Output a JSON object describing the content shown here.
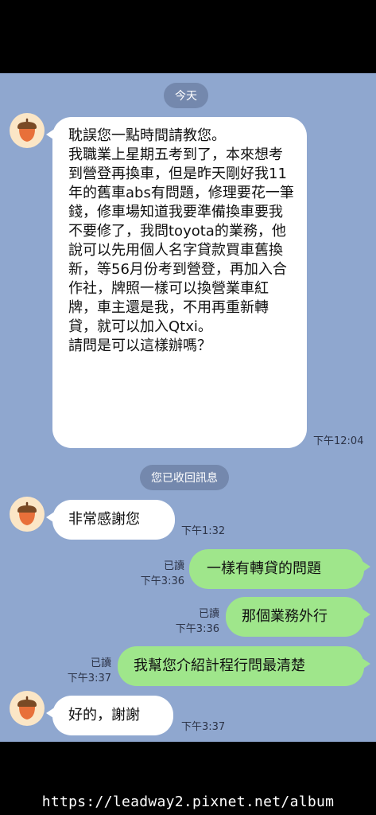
{
  "chat": {
    "date_label": "今天",
    "recalled_label": "您已收回訊息",
    "messages": [
      {
        "side": "in",
        "text": "耽誤您一點時間請教您。\n我職業上星期五考到了，本來想考到營登再換車，但是昨天剛好我11年的舊車abs有問題，修理要花一筆錢，修車場知道我要準備換車要我不要修了，我問toyota的業務，他說可以先用個人名字貸款買車舊換新，等56月份考到營登，再加入合作社，牌照一樣可以換營業車紅牌，車主還是我，不用再重新轉貸，就可以加入Qtxi。\n請問是可以這樣辦嗎？",
        "time": "下午12:04"
      },
      {
        "side": "in",
        "text": "非常感謝您",
        "time": "下午1:32"
      },
      {
        "side": "out",
        "text": "一樣有轉貸的問題",
        "read": "已讀",
        "time": "下午3:36"
      },
      {
        "side": "out",
        "text": "那個業務外行",
        "read": "已讀",
        "time": "下午3:36"
      },
      {
        "side": "out",
        "text": "我幫您介紹計程行問最清楚",
        "read": "已讀",
        "time": "下午3:37"
      },
      {
        "side": "in",
        "text": "好的，謝謝",
        "time": "下午3:37"
      }
    ]
  },
  "watermark": "https://leadway2.pixnet.net/album",
  "colors": {
    "chat_background": "#8fa7cf",
    "incoming_bubble": "#ffffff",
    "outgoing_bubble": "#9fe68b",
    "pill": "#7488ad"
  },
  "icons": {
    "avatar": "acorn-icon"
  }
}
